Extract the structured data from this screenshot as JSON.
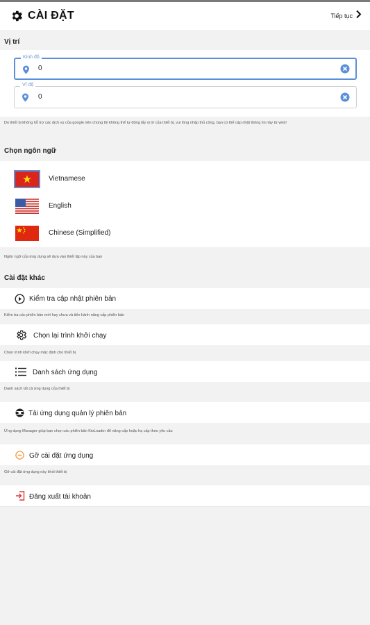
{
  "header": {
    "title": "CÀI ĐẶT",
    "next_label": "Tiếp tục",
    "icons": {
      "settings": "gear-icon",
      "next": "chevron-right-icon"
    }
  },
  "location": {
    "section_title": "Vị trí",
    "longitude": {
      "label": "Kinh độ",
      "value": "0"
    },
    "latitude": {
      "label": "Vĩ độ",
      "value": "0"
    },
    "note": "Do thiết bị không hỗ trợ các dịch vụ của google nên chúng tôi không thể tự động lấy vị trí của thiết bị, vui lòng nhập thủ công, bạn có thể cập nhật thông tin này từ web!"
  },
  "language": {
    "section_title": "Chọn ngôn ngữ",
    "options": [
      {
        "label": "Vietnamese",
        "flag": "vietnam-flag",
        "selected": true
      },
      {
        "label": "English",
        "flag": "usa-flag",
        "selected": false
      },
      {
        "label": "Chinese (Simplified)",
        "flag": "china-flag",
        "selected": false
      }
    ],
    "note": "Ngôn ngữ của ứng dụng sẽ dựa vào thiết lập này của bạn"
  },
  "other": {
    "section_title": "Cài đặt khác",
    "items": [
      {
        "label": "Kiểm tra cập nhật phiên bản",
        "icon": "update-icon",
        "note": "Kiểm tra các phiên bản mới hay chưa và tiến hành nâng cấp phiên bản"
      },
      {
        "label": "Chọn lại trình khởi chạy",
        "icon": "cog-icon",
        "note": "Chọn trình khởi chạy mặc định cho thiết bị"
      },
      {
        "label": "Danh sách ứng dụng",
        "icon": "list-icon",
        "note": "Danh sách tất cả ứng dụng của thiết bị"
      },
      {
        "label": "Tải ứng dụng quản lý phiên bản",
        "icon": "download-manager-icon",
        "note": "Ứng dụng Manager giúp bạn chọn các phiên bản KioLoader để nâng cấp hoặc hạ cấp theo yêu cầu"
      },
      {
        "label": "Gỡ cài đặt ứng dụng",
        "icon": "uninstall-icon",
        "note": "Gỡ cài đặt ứng dụng này khỏi thiết bị"
      },
      {
        "label": "Đăng xuất tài khoản",
        "icon": "logout-icon",
        "note": ""
      }
    ]
  },
  "colors": {
    "accent": "#5b8fd9",
    "danger": "#e0393e",
    "warning": "#f39a3b",
    "background": "#f2f2f2"
  }
}
